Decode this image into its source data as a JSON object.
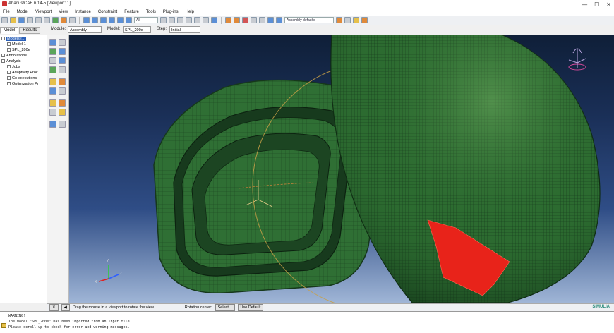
{
  "window": {
    "title": "Abaqus/CAE 6.14-5 [Viewport: 1]",
    "controls": [
      "—",
      "☐",
      "✕"
    ]
  },
  "menu": [
    "File",
    "Model",
    "Viewport",
    "View",
    "Instance",
    "Constraint",
    "Feature",
    "Tools",
    "Plug-ins",
    "Help"
  ],
  "toolbar": {
    "field_value": "All",
    "render_style": "Assembly defaults"
  },
  "tabs": [
    "Model",
    "Results"
  ],
  "context": {
    "module_label": "Module:",
    "module": "Assembly",
    "model_label": "Model:",
    "model": "SPL_200e",
    "step_label": "Step:",
    "step": "Initial"
  },
  "tree": [
    {
      "label": "Models (1)",
      "indent": 0,
      "selected": true
    },
    {
      "label": "Model-1",
      "indent": 1,
      "selected": false
    },
    {
      "label": "SPL_200e",
      "indent": 1,
      "selected": false
    },
    {
      "label": "Annotations",
      "indent": 0,
      "selected": false
    },
    {
      "label": "Analysis",
      "indent": 0,
      "selected": false
    },
    {
      "label": "Jobs",
      "indent": 1,
      "selected": false
    },
    {
      "label": "Adaptivity Proc",
      "indent": 1,
      "selected": false
    },
    {
      "label": "Co-executions",
      "indent": 1,
      "selected": false
    },
    {
      "label": "Optimization Pr",
      "indent": 1,
      "selected": false
    }
  ],
  "prompt": {
    "text": "Drag the mouse in a viewport to rotate the view",
    "rotation_label": "Rotation center:",
    "select_btn": "Select...",
    "default_btn": "Use Default"
  },
  "messages": [
    "WARNING!",
    "The model \"SPL_200e\" has been imported from an input file.",
    "Please scroll up to check for error and warning messages."
  ],
  "brand": "SIMULIA",
  "colors": {
    "mesh_green": "#2c6b30",
    "highlight_red": "#e8231a",
    "accent_blue": "#2a5fb8"
  }
}
